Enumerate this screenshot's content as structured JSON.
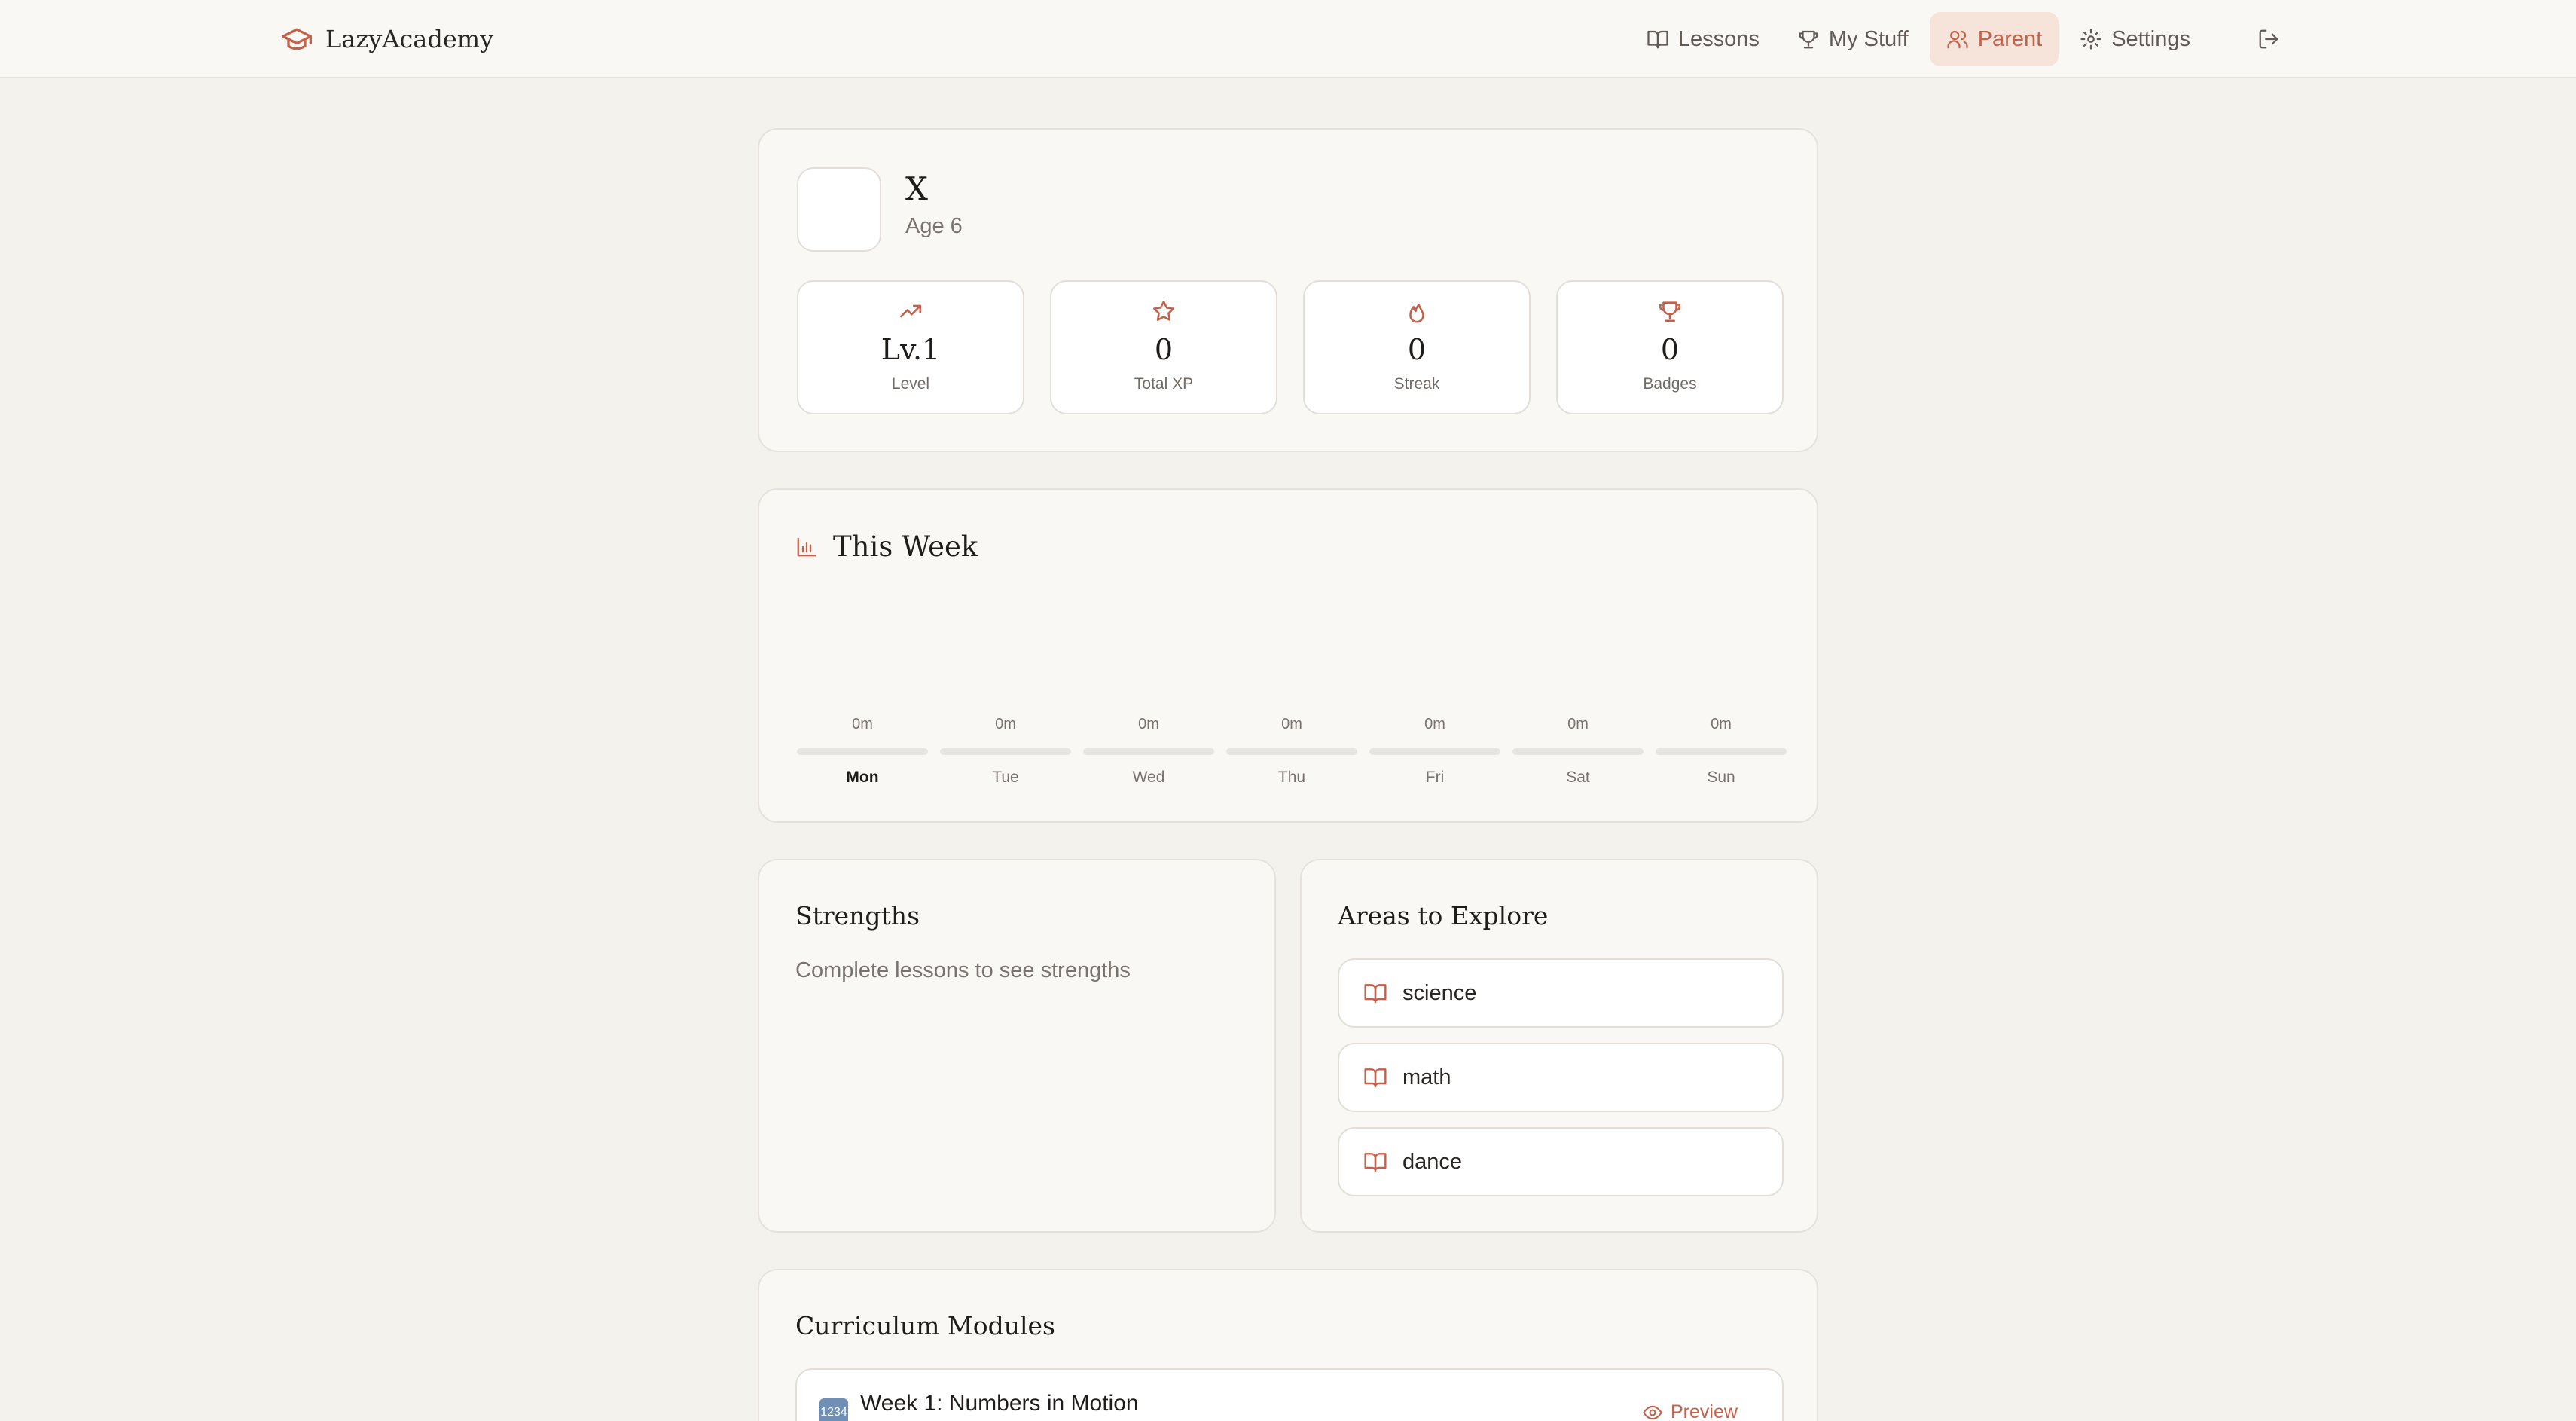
{
  "app": {
    "name": "LazyAcademy"
  },
  "nav": {
    "items": [
      {
        "label": "Lessons",
        "icon": "book-open-icon"
      },
      {
        "label": "My Stuff",
        "icon": "trophy-icon"
      },
      {
        "label": "Parent",
        "icon": "users-icon",
        "active": true
      },
      {
        "label": "Settings",
        "icon": "gear-icon"
      }
    ],
    "logout_icon": "logout-icon"
  },
  "profile": {
    "name": "X",
    "age": "Age 6",
    "stats": [
      {
        "value": "Lv.1",
        "label": "Level",
        "icon": "trending-up-icon"
      },
      {
        "value": "0",
        "label": "Total XP",
        "icon": "star-icon"
      },
      {
        "value": "0",
        "label": "Streak",
        "icon": "flame-icon"
      },
      {
        "value": "0",
        "label": "Badges",
        "icon": "trophy-icon"
      }
    ]
  },
  "week": {
    "title": "This Week",
    "days": [
      {
        "label": "Mon",
        "minutes": "0m",
        "today": true
      },
      {
        "label": "Tue",
        "minutes": "0m"
      },
      {
        "label": "Wed",
        "minutes": "0m"
      },
      {
        "label": "Thu",
        "minutes": "0m"
      },
      {
        "label": "Fri",
        "minutes": "0m"
      },
      {
        "label": "Sat",
        "minutes": "0m"
      },
      {
        "label": "Sun",
        "minutes": "0m"
      }
    ]
  },
  "strengths": {
    "title": "Strengths",
    "empty": "Complete lessons to see strengths"
  },
  "explore": {
    "title": "Areas to Explore",
    "items": [
      {
        "label": "science"
      },
      {
        "label": "math"
      },
      {
        "label": "dance"
      }
    ]
  },
  "modules": {
    "title": "Curriculum Modules",
    "items": [
      {
        "title": "Week 1: Numbers in Motion",
        "action": "Preview",
        "emoji_text": "1234"
      }
    ]
  },
  "colors": {
    "accent": "#c4614a",
    "accent_bg": "#f6e4da",
    "page_bg": "#f4f2ec",
    "card_bg": "#f9f8f5"
  }
}
